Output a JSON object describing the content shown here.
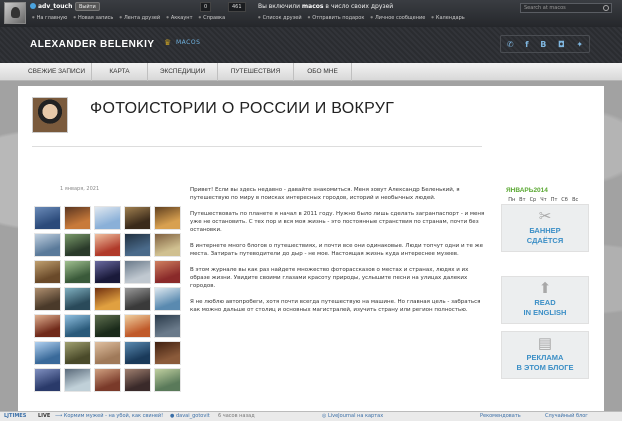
{
  "ljbar": {
    "username": "adv_touch",
    "logout_label": "Выйти",
    "count1": "0",
    "count2": "461",
    "links": [
      "На главную",
      "Новая запись",
      "Лента друзей",
      "Аккаунт",
      "Справка"
    ],
    "friends_pre": "Вы включили",
    "friends_user": "macos",
    "friends_post": "в число своих друзей",
    "links2": [
      "Список друзей",
      "Отправить подарок",
      "Личное сообщение",
      "Календарь"
    ],
    "search_placeholder": "Search at macos"
  },
  "header": {
    "title": "ALEXANDER BELENKIY",
    "site": "MACOS",
    "social": [
      "✆",
      "f",
      "B",
      "◘",
      "✦"
    ]
  },
  "nav": {
    "tabs": [
      "СВЕЖИЕ ЗАПИСИ",
      "КАРТА",
      "ЭКСПЕДИЦИИ",
      "ПУТЕШЕСТВИЯ",
      "ОБО МНЕ"
    ]
  },
  "post": {
    "title": "ФОТОИСТОРИИ О РОССИИ И ВОКРУГ",
    "date": "1 января, 2021",
    "paragraphs": [
      "Привет! Если вы здесь недавно - давайте знакомиться. Меня зовут Александр Беленький, я путешествую по миру в поисках интересных городов, историй и необычных людей.",
      "Путешествовать по планете я начал  в 2011 году. Нужно было лишь сделать загранпаспорт - и меня уже не остановить. С тех пор и вся моя жизнь - это постоянные странствия по странам, почти без остановки.",
      "В интернете много блогов о путешествиях, и почти все они одинаковые. Люди топчут одни и те же места. Затирать путеводители до дыр - не мое. Настоящая жизнь куда интереснее музеев.",
      "В этом журнале вы как раз найдете множество фоторассказов о местах и странах, людях и их образе жизни. Увидите своими глазами красоту природы, услышите песни на улицах далеких городов.",
      "Я не люблю автопробеги, хотя почти всегда путешествую на машине. Но главная цель - забраться как можно дальше от столиц и основных магистралей, изучить страну или регион полностью."
    ]
  },
  "calendar": {
    "month": "ЯНВАРЬ2014",
    "weekdays": [
      "Пн",
      "Вт",
      "Ср",
      "Чт",
      "Пт",
      "Сб",
      "Вс"
    ],
    "rows": [
      [
        "",
        "",
        "1",
        "2",
        "3",
        "4",
        "5"
      ],
      [
        "6",
        "7",
        "8",
        "9",
        "10",
        "11",
        "12"
      ],
      [
        "13",
        "14",
        "15",
        "16",
        "17",
        "18",
        "19"
      ],
      [
        "20",
        "21",
        "22",
        "23",
        "24",
        "25",
        "26"
      ],
      [
        "27",
        "28",
        "29",
        "30",
        "31",
        "",
        ""
      ]
    ],
    "linked_days": [
      "1",
      "2",
      "3",
      "4",
      "5",
      "6",
      "7",
      "8",
      "9",
      "10",
      "11",
      "12",
      "13",
      "14",
      "15",
      "16",
      "17"
    ]
  },
  "banners": [
    {
      "icon": "scissors-icon",
      "line1": "БАННЕР",
      "line2": "СДАЁТСЯ"
    },
    {
      "icon": "arrow-icon",
      "line1": "READ",
      "line2": "IN ENGLISH"
    },
    {
      "icon": "document-icon",
      "line1": "РЕКЛАМА",
      "line2": "В ЭТОМ БЛОГЕ"
    }
  ],
  "bottombar": {
    "logo": "LJTIMES",
    "live": "LIVE",
    "headline": "Кормим мужей - на убой, как свиней!",
    "user": "davai_gotovit",
    "time": "6 часов назад",
    "map": "LiveJournal на картах",
    "recommend": "Рекомендовать",
    "random": "Случайный блог"
  },
  "colors": {
    "accent_blue": "#3c8fc6",
    "calendar_green": "#5aa832",
    "bar_dark": "#2a2c30"
  }
}
